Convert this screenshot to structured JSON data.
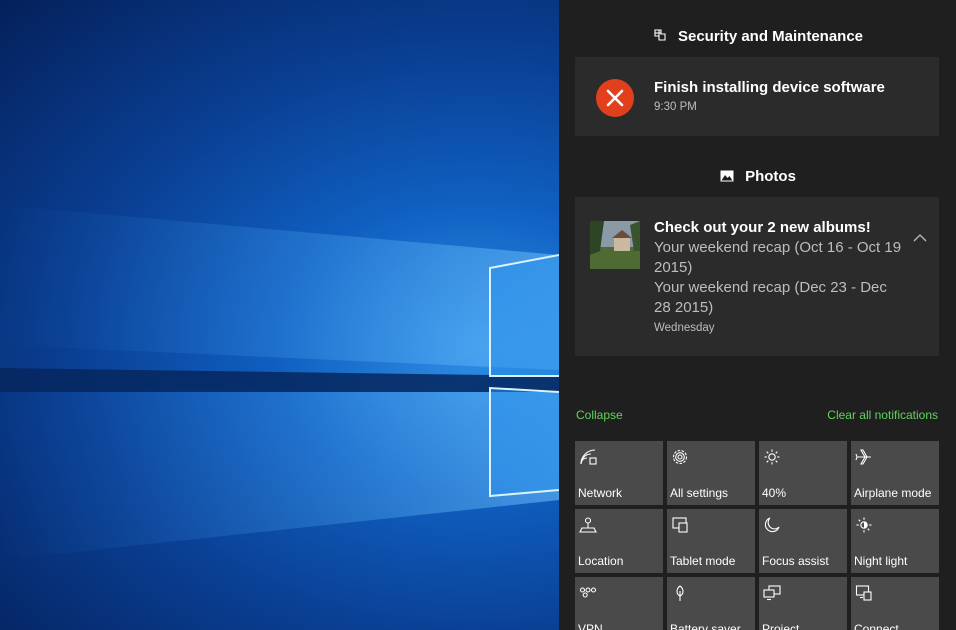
{
  "action_center": {
    "security_group": {
      "title": "Security and Maintenance",
      "notification": {
        "title": "Finish installing device software",
        "time": "9:30 PM"
      }
    },
    "photos_group": {
      "title": "Photos",
      "notification": {
        "title": "Check out your 2 new albums!",
        "line1": "Your weekend recap (Oct 16 - Oct 19 2015)",
        "line2": "Your weekend recap (Dec 23 - Dec 28 2015)",
        "time": "Wednesday"
      }
    },
    "collapse_label": "Collapse",
    "clear_all_label": "Clear all notifications",
    "quick_actions": [
      {
        "label": "Network",
        "icon": "network-icon"
      },
      {
        "label": "All settings",
        "icon": "gear-icon"
      },
      {
        "label": "40%",
        "icon": "brightness-icon"
      },
      {
        "label": "Airplane mode",
        "icon": "airplane-icon"
      },
      {
        "label": "Location",
        "icon": "location-icon"
      },
      {
        "label": "Tablet mode",
        "icon": "tablet-mode-icon"
      },
      {
        "label": "Focus assist",
        "icon": "moon-icon"
      },
      {
        "label": "Night light",
        "icon": "night-light-icon"
      },
      {
        "label": "VPN",
        "icon": "vpn-icon"
      },
      {
        "label": "Battery saver",
        "icon": "battery-saver-icon"
      },
      {
        "label": "Project",
        "icon": "project-icon"
      },
      {
        "label": "Connect",
        "icon": "connect-icon"
      }
    ],
    "colors": {
      "panel_bg": "#1f1f1f",
      "card_bg": "#2b2b2b",
      "tile_bg": "#4a4a4a",
      "link_green": "#5fd35b",
      "error_red": "#e2401c"
    }
  }
}
